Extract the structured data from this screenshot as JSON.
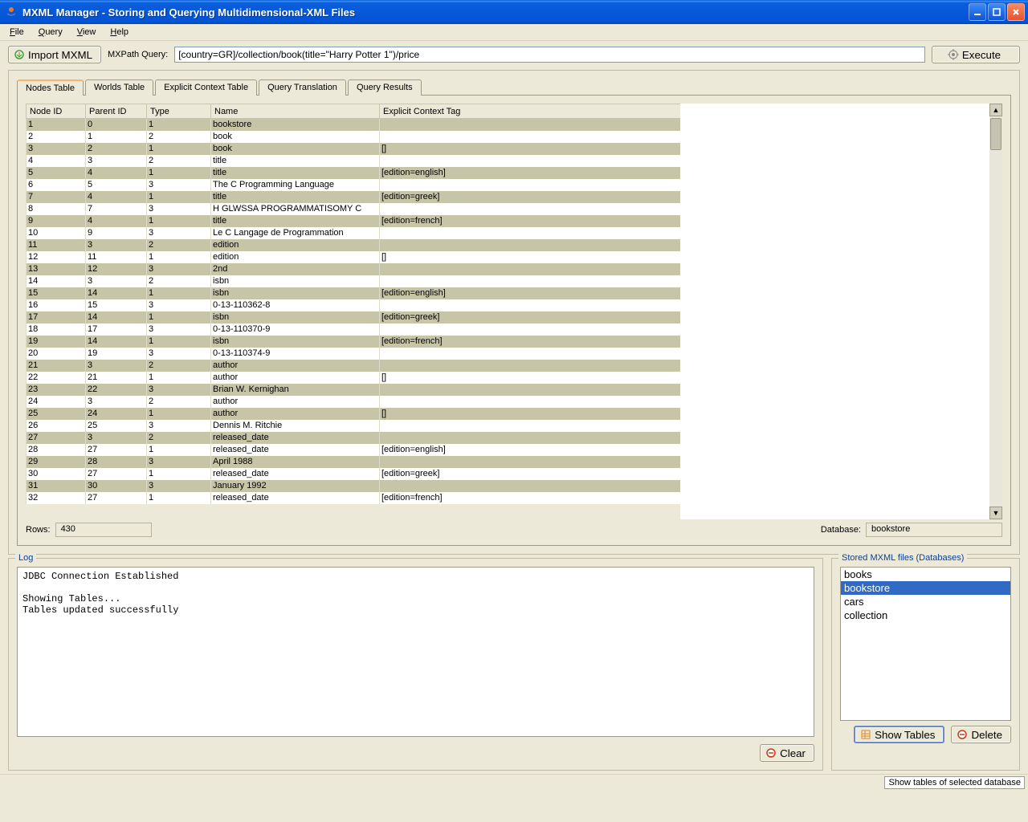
{
  "window": {
    "title": "MXML Manager - Storing and Querying Multidimensional-XML Files"
  },
  "menubar": {
    "file": "File",
    "query": "Query",
    "view": "View",
    "help": "Help"
  },
  "toolbar": {
    "import_label": "Import MXML",
    "query_label": "MXPath Query:",
    "query_value": "[country=GR]/collection/book(title=\"Harry Potter 1\")/price",
    "execute_label": "Execute"
  },
  "tabs": {
    "nodes": "Nodes Table",
    "worlds": "Worlds Table",
    "explicit": "Explicit Context Table",
    "translation": "Query Translation",
    "results": "Query Results"
  },
  "table": {
    "headers": {
      "node_id": "Node ID",
      "parent_id": "Parent ID",
      "type": "Type",
      "name": "Name",
      "explicit_context": "Explicit Context Tag"
    },
    "rows": [
      {
        "id": "1",
        "parent": "0",
        "type": "1",
        "name": "bookstore",
        "ctx": ""
      },
      {
        "id": "2",
        "parent": "1",
        "type": "2",
        "name": "book",
        "ctx": ""
      },
      {
        "id": "3",
        "parent": "2",
        "type": "1",
        "name": "book",
        "ctx": "[]"
      },
      {
        "id": "4",
        "parent": "3",
        "type": "2",
        "name": "title",
        "ctx": ""
      },
      {
        "id": "5",
        "parent": "4",
        "type": "1",
        "name": "title",
        "ctx": "[edition=english]"
      },
      {
        "id": "6",
        "parent": "5",
        "type": "3",
        "name": "The C Programming Language",
        "ctx": ""
      },
      {
        "id": "7",
        "parent": "4",
        "type": "1",
        "name": "title",
        "ctx": "[edition=greek]"
      },
      {
        "id": "8",
        "parent": "7",
        "type": "3",
        "name": "H GLWSSA PROGRAMMATISOMY C",
        "ctx": ""
      },
      {
        "id": "9",
        "parent": "4",
        "type": "1",
        "name": "title",
        "ctx": "[edition=french]"
      },
      {
        "id": "10",
        "parent": "9",
        "type": "3",
        "name": "Le C Langage de Programmation",
        "ctx": ""
      },
      {
        "id": "11",
        "parent": "3",
        "type": "2",
        "name": "edition",
        "ctx": ""
      },
      {
        "id": "12",
        "parent": "11",
        "type": "1",
        "name": "edition",
        "ctx": "[]"
      },
      {
        "id": "13",
        "parent": "12",
        "type": "3",
        "name": "2nd",
        "ctx": ""
      },
      {
        "id": "14",
        "parent": "3",
        "type": "2",
        "name": "isbn",
        "ctx": ""
      },
      {
        "id": "15",
        "parent": "14",
        "type": "1",
        "name": "isbn",
        "ctx": "[edition=english]"
      },
      {
        "id": "16",
        "parent": "15",
        "type": "3",
        "name": "0-13-110362-8",
        "ctx": ""
      },
      {
        "id": "17",
        "parent": "14",
        "type": "1",
        "name": "isbn",
        "ctx": "[edition=greek]"
      },
      {
        "id": "18",
        "parent": "17",
        "type": "3",
        "name": "0-13-110370-9",
        "ctx": ""
      },
      {
        "id": "19",
        "parent": "14",
        "type": "1",
        "name": "isbn",
        "ctx": "[edition=french]"
      },
      {
        "id": "20",
        "parent": "19",
        "type": "3",
        "name": "0-13-110374-9",
        "ctx": ""
      },
      {
        "id": "21",
        "parent": "3",
        "type": "2",
        "name": "author",
        "ctx": ""
      },
      {
        "id": "22",
        "parent": "21",
        "type": "1",
        "name": "author",
        "ctx": "[]"
      },
      {
        "id": "23",
        "parent": "22",
        "type": "3",
        "name": "Brian W. Kernighan",
        "ctx": ""
      },
      {
        "id": "24",
        "parent": "3",
        "type": "2",
        "name": "author",
        "ctx": ""
      },
      {
        "id": "25",
        "parent": "24",
        "type": "1",
        "name": "author",
        "ctx": "[]"
      },
      {
        "id": "26",
        "parent": "25",
        "type": "3",
        "name": "Dennis M. Ritchie",
        "ctx": ""
      },
      {
        "id": "27",
        "parent": "3",
        "type": "2",
        "name": "released_date",
        "ctx": ""
      },
      {
        "id": "28",
        "parent": "27",
        "type": "1",
        "name": "released_date",
        "ctx": "[edition=english]"
      },
      {
        "id": "29",
        "parent": "28",
        "type": "3",
        "name": "April 1988",
        "ctx": ""
      },
      {
        "id": "30",
        "parent": "27",
        "type": "1",
        "name": "released_date",
        "ctx": "[edition=greek]"
      },
      {
        "id": "31",
        "parent": "30",
        "type": "3",
        "name": "January 1992",
        "ctx": ""
      },
      {
        "id": "32",
        "parent": "27",
        "type": "1",
        "name": "released_date",
        "ctx": "[edition=french]"
      }
    ]
  },
  "status": {
    "rows_label": "Rows:",
    "rows_value": "430",
    "db_label": "Database:",
    "db_value": "bookstore"
  },
  "log": {
    "legend": "Log",
    "content": "JDBC Connection Established\n\nShowing Tables...\nTables updated successfully",
    "clear_label": "Clear"
  },
  "stored": {
    "legend": "Stored MXML files (Databases)",
    "items": [
      "books",
      "bookstore",
      "cars",
      "collection"
    ],
    "selected_index": 1,
    "show_tables_label": "Show Tables",
    "delete_label": "Delete"
  },
  "statusbar": {
    "text": "Show tables of selected database"
  }
}
